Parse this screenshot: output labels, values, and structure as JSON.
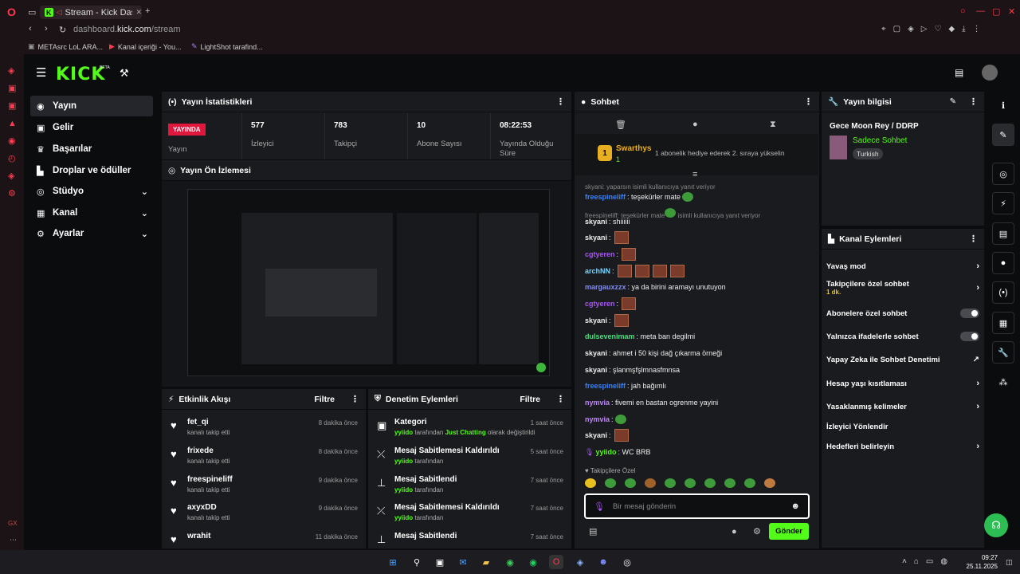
{
  "browser": {
    "tab_title": "Stream - Kick Dashbo",
    "url_prefix": "dashboard.",
    "url_domain": "kick.com",
    "url_path": "/stream",
    "bookmarks": [
      "METAsrc LoL ARA...",
      "Kanal içeriği - You...",
      "LightShot tarafind..."
    ]
  },
  "app": {
    "logo": "KICK",
    "beta": "BETA"
  },
  "nav": [
    {
      "label": "Yayın",
      "icon": "broadcast-icon"
    },
    {
      "label": "Gelir",
      "icon": "revenue-icon"
    },
    {
      "label": "Başarılar",
      "icon": "trophy-icon"
    },
    {
      "label": "Droplar ve ödüller",
      "icon": "drops-icon"
    },
    {
      "label": "Stüdyo",
      "icon": "studio-icon"
    },
    {
      "label": "Kanal",
      "icon": "channel-icon"
    },
    {
      "label": "Ayarlar",
      "icon": "settings-icon"
    }
  ],
  "stats": {
    "title": "Yayın İstatistikleri",
    "live": "YAYINDA",
    "live_label": "Yayın",
    "items": [
      {
        "value": "577",
        "label": "İzleyici"
      },
      {
        "value": "783",
        "label": "Takipçi"
      },
      {
        "value": "10",
        "label": "Abone Sayısı"
      },
      {
        "value": "08:22:53",
        "label": "Yayında Olduğu Süre"
      }
    ]
  },
  "preview": {
    "title": "Yayın Ön İzlemesi"
  },
  "activity": {
    "title": "Etkinlik Akışı",
    "filter": "Filtre",
    "items": [
      {
        "name": "fet_qi",
        "text": "kanalı takip etti",
        "time": "8 dakika önce"
      },
      {
        "name": "frixede",
        "text": "kanalı takip etti",
        "time": "8 dakika önce"
      },
      {
        "name": "freespineliff",
        "text": "kanalı takip etti",
        "time": "9 dakika önce"
      },
      {
        "name": "axyxDD",
        "text": "kanalı takip etti",
        "time": "9 dakika önce"
      },
      {
        "name": "wrahit",
        "text": "",
        "time": "11 dakika önce"
      }
    ]
  },
  "moderation": {
    "title": "Denetim Eylemleri",
    "filter": "Filtre",
    "items": [
      {
        "title": "Kategori",
        "user": "yyiido",
        "text": " tarafından ",
        "extra": "Just Chatting",
        "after": " olarak değiştirildi",
        "time": "1 saat önce"
      },
      {
        "title": "Mesaj Sabitlemesi Kaldırıldı",
        "user": "yyiido",
        "text": " tarafından",
        "extra": "",
        "after": "",
        "time": "5 saat önce"
      },
      {
        "title": "Mesaj Sabitlendi",
        "user": "yyiido",
        "text": " tarafından",
        "extra": "",
        "after": "",
        "time": "7 saat önce"
      },
      {
        "title": "Mesaj Sabitlemesi Kaldırıldı",
        "user": "yyiido",
        "text": " tarafından",
        "extra": "",
        "after": "",
        "time": "7 saat önce"
      },
      {
        "title": "Mesaj Sabitlendi",
        "user": "",
        "text": "",
        "extra": "",
        "after": "",
        "time": "7 saat önce"
      }
    ]
  },
  "chat": {
    "title": "Sohbet",
    "gift_user": "Swarthys",
    "gift_count": "1",
    "gift_text": "1 abonelik hediye ederek 2. sıraya yükselin",
    "reply1": "skyani: yaparsın isimli kullanıcıya yanıt veriyor",
    "reply2": "freespineliff: teşekürler mate",
    "reply2b": " isimli kullanıcıya yanıt veriyor",
    "messages": [
      {
        "user": "freespineliff",
        "color": "#3b82f6",
        "text": ": teşekürler mate"
      },
      {
        "user": "skyani",
        "color": "#e8e8e8",
        "text": ": shiiiiii"
      },
      {
        "user": "skyani",
        "color": "#e8e8e8",
        "text": ":"
      },
      {
        "user": "cgtyeren",
        "color": "#a855f7",
        "text": ":"
      },
      {
        "user": "archNN",
        "color": "#7dd3fc",
        "text": ":"
      },
      {
        "user": "margauxzzx",
        "color": "#818cf8",
        "text": ": ya da birini aramayı unutuyon"
      },
      {
        "user": "cgtyeren",
        "color": "#a855f7",
        "text": ":"
      },
      {
        "user": "skyani",
        "color": "#e8e8e8",
        "text": ":"
      },
      {
        "user": "dulsevenimam",
        "color": "#4ade80",
        "text": ": meta ban degilmi"
      },
      {
        "user": "skyani",
        "color": "#e8e8e8",
        "text": ": ahmet i 50 kişi dağ çıkarma örneği"
      },
      {
        "user": "skyani",
        "color": "#e8e8e8",
        "text": ": şlanmşfşlmnasfmnsa"
      },
      {
        "user": "freespineliff",
        "color": "#3b82f6",
        "text": ": jah bağımlı"
      },
      {
        "user": "nymvia",
        "color": "#c084fc",
        "text": ": fivemi en bastan ogrenme yayini"
      },
      {
        "user": "nymvia",
        "color": "#c084fc",
        "text": ":"
      },
      {
        "user": "skyani",
        "color": "#e8e8e8",
        "text": ":"
      },
      {
        "user": "yyiido",
        "color": "#53fc18",
        "text": ": WC BRB"
      }
    ],
    "follower_only": "Takipçilere Özel",
    "placeholder": "Bir mesaj gönderin",
    "send": "Gönder"
  },
  "stream_info": {
    "title": "Yayın bilgisi",
    "stream_title": "Gece Moon Rey / DDRP",
    "category": "Sadece Sohbet",
    "language": "Turkish"
  },
  "channel_actions": {
    "title": "Kanal Eylemleri",
    "items": [
      {
        "label": "Yavaş mod",
        "sub": "",
        "kind": "arrow"
      },
      {
        "label": "Takipçilere özel sohbet",
        "sub": "1 dk.",
        "kind": "arrow"
      },
      {
        "label": "Abonelere özel sohbet",
        "sub": "",
        "kind": "toggle"
      },
      {
        "label": "Yalnızca ifadelerle sohbet",
        "sub": "",
        "kind": "toggle"
      },
      {
        "label": "Yapay Zeka ile Sohbet Denetimi",
        "sub": "",
        "kind": "ext"
      },
      {
        "label": "Hesap yaşı kısıtlaması",
        "sub": "",
        "kind": "arrow"
      },
      {
        "label": "Yasaklanmış kelimeler",
        "sub": "",
        "kind": "arrow"
      },
      {
        "label": "İzleyici Yönlendir",
        "sub": "",
        "kind": "none"
      },
      {
        "label": "Hedefleri belirleyin",
        "sub": "",
        "kind": "arrow"
      }
    ]
  },
  "taskbar": {
    "time": "09:27",
    "date": "25.11.2025"
  }
}
